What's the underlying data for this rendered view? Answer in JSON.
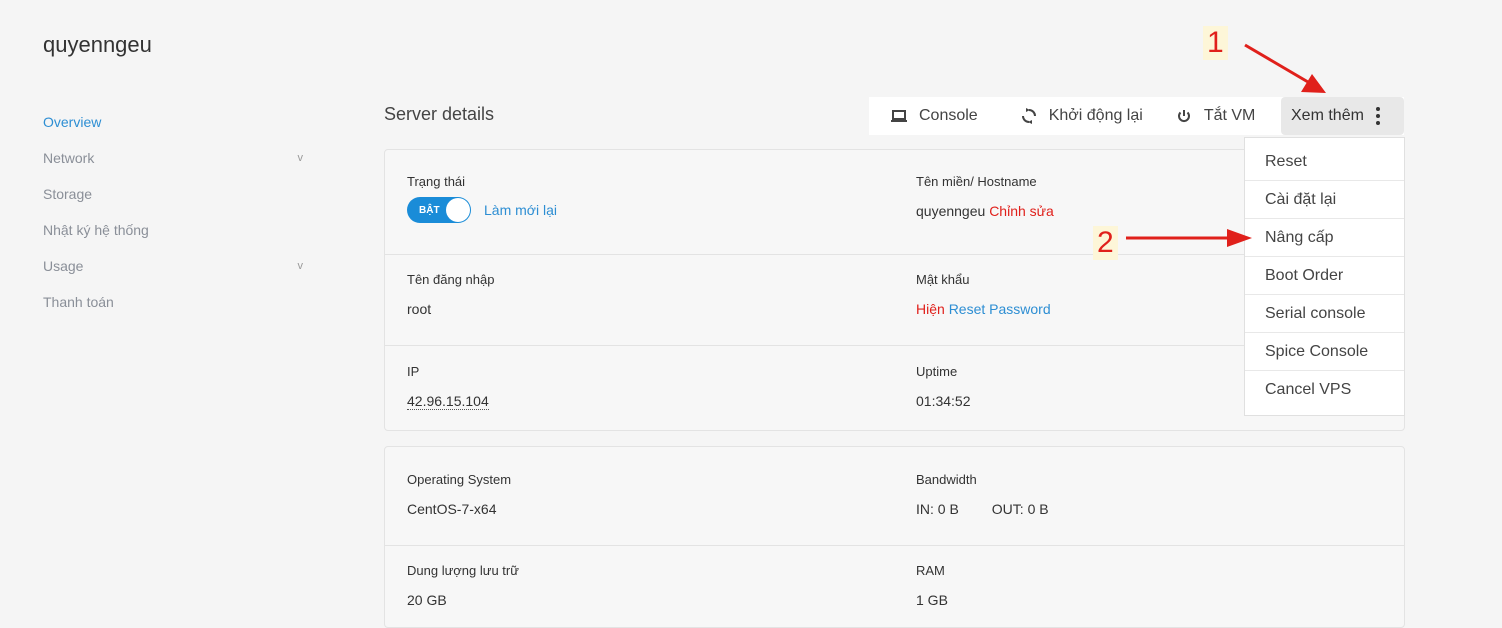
{
  "server": {
    "name": "quyenngeu"
  },
  "sidebar": {
    "items": [
      {
        "label": "Overview",
        "chevron": ""
      },
      {
        "label": "Network",
        "chevron": "v"
      },
      {
        "label": "Storage",
        "chevron": ""
      },
      {
        "label": "Nhật ký hệ thống",
        "chevron": ""
      },
      {
        "label": "Usage",
        "chevron": "v"
      },
      {
        "label": "Thanh toán",
        "chevron": ""
      }
    ]
  },
  "main": {
    "title": "Server details"
  },
  "toolbar": {
    "console": "Console",
    "restart": "Khởi động lại",
    "power_off": "Tắt VM",
    "more": "Xem thêm"
  },
  "details": {
    "status_label": "Trạng thái",
    "status_toggle": "BẬT",
    "refresh": "Làm mới lại",
    "hostname_label": "Tên miền/ Hostname",
    "hostname_value": "quyenngeu",
    "edit": "Chỉnh sửa",
    "username_label": "Tên đăng nhập",
    "username_value": "root",
    "password_label": "Mật khẩu",
    "show": "Hiện",
    "reset_password": "Reset Password",
    "ip_label": "IP",
    "ip_value": "42.96.15.104",
    "uptime_label": "Uptime",
    "uptime_value": "01:34:52"
  },
  "specs": {
    "os_label": "Operating System",
    "os_value": "CentOS-7-x64",
    "bandwidth_label": "Bandwidth",
    "bandwidth_in": "IN: 0 B",
    "bandwidth_out": "OUT: 0 B",
    "storage_label": "Dung lượng lưu trữ",
    "storage_value": "20 GB",
    "ram_label": "RAM",
    "ram_value": "1 GB"
  },
  "menu": {
    "items": [
      "Reset",
      "Cài đặt lại",
      "Nâng cấp",
      "Boot Order",
      "Serial console",
      "Spice Console",
      "Cancel VPS"
    ]
  },
  "annotations": {
    "step1": "1",
    "step2": "2",
    "color": "#e0201b"
  }
}
